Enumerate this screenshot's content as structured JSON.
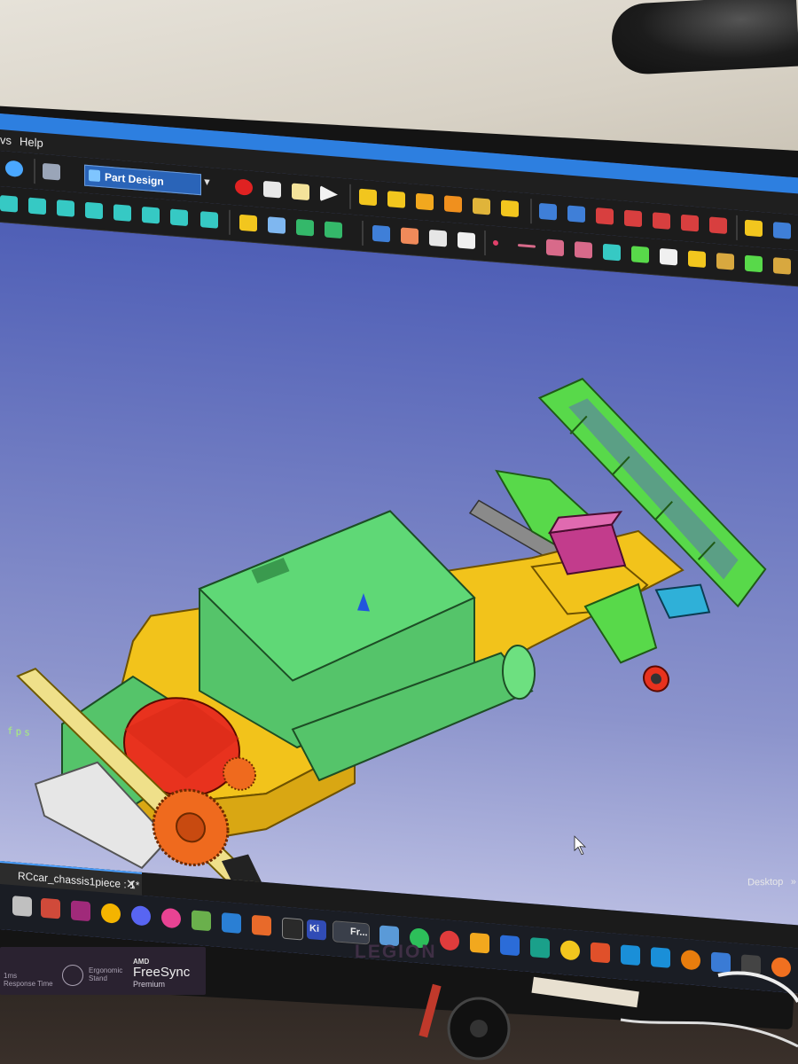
{
  "menu": {
    "views_fragment": "vs",
    "help": "Help"
  },
  "workbench": {
    "selected": "Part Design"
  },
  "viewport": {
    "fps_label": "fps"
  },
  "document_tab": {
    "label": "RCcar_chassis1piece : 1*",
    "close": "✕"
  },
  "taskbar": {
    "freecad_label": "Fr...",
    "kicad_label": "Ki",
    "desktop_label": "Desktop",
    "overflow": "»"
  },
  "monitor": {
    "brand": "LEGION",
    "sticker": {
      "response_line1": "1ms",
      "response_line2": "Response Time",
      "ergonomic_line1": "Ergonomic",
      "ergonomic_line2": "Stand",
      "amd": "AMD",
      "freesync": "FreeSync",
      "premium": "Premium"
    }
  },
  "colors": {
    "viewport_top": "#4f5fb6",
    "viewport_bottom": "#b7bbe1",
    "chassis": "#f2c31b",
    "battery_box": "#55c46a",
    "motor": "#e8321e",
    "servo": "#c23c8c",
    "bumper": "#58d94a",
    "gear": "#ef6a1e"
  }
}
